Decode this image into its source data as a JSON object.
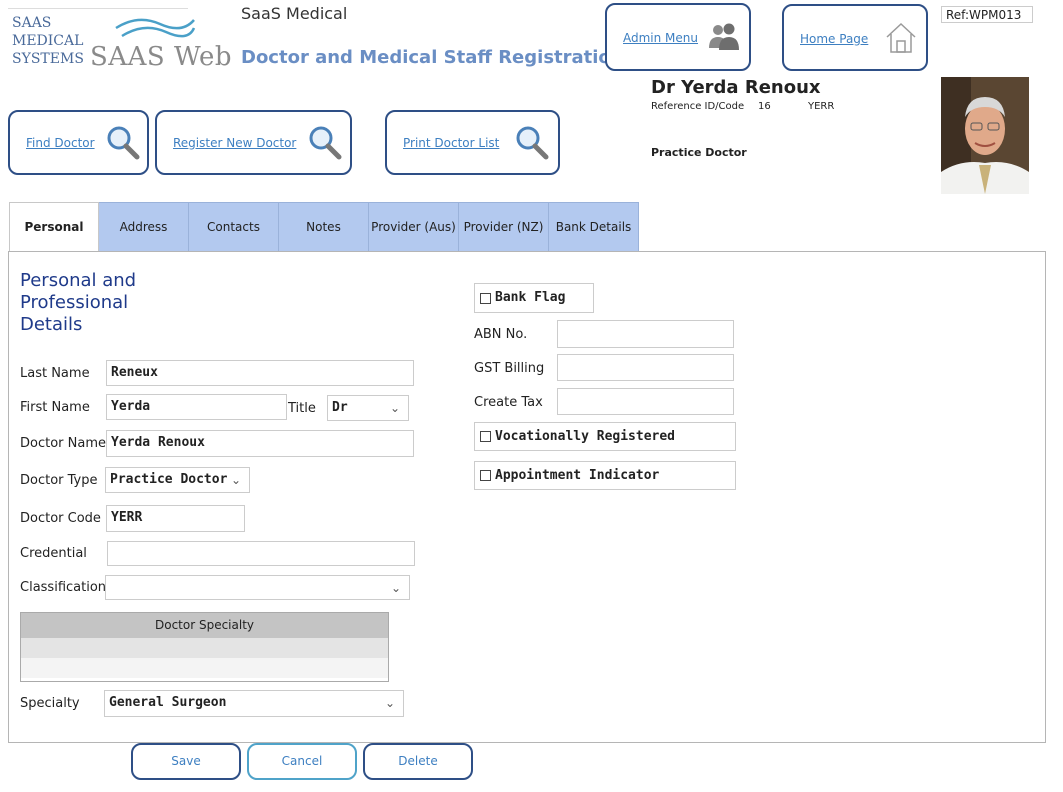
{
  "header": {
    "logo_line1": "SAAS",
    "logo_line2": "MEDICAL",
    "logo_line3": "SYSTEMS",
    "logo_brand": "SAAS Web",
    "app_name": "SaaS Medical",
    "page_title": "Doctor and Medical Staff Registration",
    "admin_menu": "Admin Menu",
    "home_page": "Home Page",
    "ref_code": "Ref:WPM013"
  },
  "actions": {
    "find_doctor": "Find Doctor",
    "register_new_doctor": "Register New Doctor",
    "print_doctor_list": "Print Doctor List"
  },
  "doctor": {
    "full_name": "Dr Yerda Renoux",
    "ref_label": "Reference ID/Code",
    "ref_id": "16",
    "ref_code": "YERR",
    "type": "Practice Doctor"
  },
  "tabs": [
    "Personal",
    "Address",
    "Contacts",
    "Notes",
    "Provider (Aus)",
    "Provider (NZ)",
    "Bank Details"
  ],
  "section_title": {
    "line1": "Personal and",
    "line2": "Professional",
    "line3": "Details"
  },
  "form": {
    "last_name_label": "Last Name",
    "last_name": "Reneux",
    "first_name_label": "First Name",
    "first_name": "Yerda",
    "title_label": "Title",
    "title": "Dr",
    "doctor_name_label": "Doctor Name",
    "doctor_name": "Yerda Renoux",
    "doctor_type_label": "Doctor Type",
    "doctor_type": "Practice Doctor",
    "doctor_code_label": "Doctor Code",
    "doctor_code": "YERR",
    "credential_label": "Credential",
    "credential": "",
    "classification_label": "Classification",
    "classification": "",
    "specialty_grid_header": "Doctor Specialty",
    "specialty_label": "Specialty",
    "specialty": "General Surgeon",
    "bank_flag": "Bank Flag",
    "abn_label": "ABN No.",
    "abn": "",
    "gst_label": "GST Billing",
    "gst": "",
    "create_tax_label": "Create Tax",
    "create_tax": "",
    "vocationally_registered": "Vocationally Registered",
    "appointment_indicator": "Appointment Indicator"
  },
  "buttons": {
    "save": "Save",
    "cancel": "Cancel",
    "delete": "Delete"
  },
  "colors": {
    "tab_bg": "#b3c9ef",
    "button_border": "#2e4f86",
    "link": "#3d7fc1",
    "title": "#6a8ec4",
    "section": "#1f3a8a"
  },
  "icons": [
    "search-icon",
    "users-icon",
    "home-icon"
  ]
}
